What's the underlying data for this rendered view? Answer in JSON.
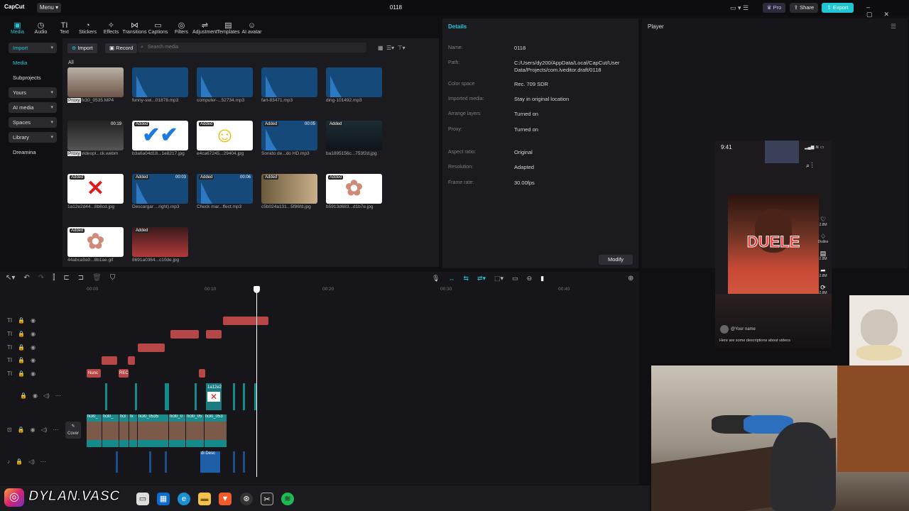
{
  "app": {
    "logo": "CapCut",
    "menu_label": "Menu",
    "project_title": "0118"
  },
  "titlebar": {
    "pro_label": "Pro",
    "share_label": "Share",
    "export_label": "Export"
  },
  "tool_tabs": [
    {
      "label": "Media",
      "icon": "media-icon",
      "glyph": "▣"
    },
    {
      "label": "Audio",
      "icon": "audio-icon",
      "glyph": "◷"
    },
    {
      "label": "Text",
      "icon": "text-icon",
      "glyph": "TI"
    },
    {
      "label": "Stickers",
      "icon": "stickers-icon",
      "glyph": "◔"
    },
    {
      "label": "Effects",
      "icon": "effects-icon",
      "glyph": "✧"
    },
    {
      "label": "Transitions",
      "icon": "transitions-icon",
      "glyph": "⋈"
    },
    {
      "label": "Captions",
      "icon": "captions-icon",
      "glyph": "▭"
    },
    {
      "label": "Filters",
      "icon": "filters-icon",
      "glyph": "◎"
    },
    {
      "label": "Adjustment",
      "icon": "adjustment-icon",
      "glyph": "⇌"
    },
    {
      "label": "Templates",
      "icon": "templates-icon",
      "glyph": "▤"
    },
    {
      "label": "AI avatar",
      "icon": "ai-avatar-icon",
      "glyph": "☺"
    }
  ],
  "sidebar": {
    "items": [
      {
        "label": "Import",
        "chevron": "▾"
      },
      {
        "label": "Media",
        "chevron": ""
      },
      {
        "label": "Subprojects",
        "chevron": ""
      },
      {
        "label": "Yours",
        "chevron": "▾"
      },
      {
        "label": "AI media",
        "chevron": "▾"
      },
      {
        "label": "Spaces",
        "chevron": "▾"
      },
      {
        "label": "Library",
        "chevron": "▾"
      },
      {
        "label": "Dreamina",
        "chevron": ""
      }
    ]
  },
  "media": {
    "import_label": "Import",
    "record_label": "Record",
    "search_placeholder": "Search media",
    "all_label": "All",
    "items": [
      {
        "caption": "fx30_0535.MP4",
        "badge": "",
        "duration": "",
        "proxy": "Proxy",
        "kind": "video"
      },
      {
        "caption": "funny-swi...01878.mp3",
        "badge": "",
        "duration": "",
        "proxy": "",
        "kind": "audio"
      },
      {
        "caption": "computer-...52734.mp3",
        "badge": "",
        "duration": "",
        "proxy": "",
        "kind": "audio"
      },
      {
        "caption": "fart-83471.mp3",
        "badge": "",
        "duration": "",
        "proxy": "",
        "kind": "audio"
      },
      {
        "caption": "ding-101492.mp3",
        "badge": "",
        "duration": "",
        "proxy": "",
        "kind": "audio"
      },
      {
        "caption": "videopl...ck.webm",
        "badge": "",
        "duration": "00:19",
        "proxy": "Proxy",
        "kind": "dark"
      },
      {
        "caption": "b3a6a04d18...1e8217.jpg",
        "badge": "Added",
        "duration": "",
        "proxy": "",
        "kind": "check"
      },
      {
        "caption": "e4ca67245...29404.jpg",
        "badge": "Added",
        "duration": "",
        "proxy": "",
        "kind": "emoji"
      },
      {
        "caption": "Sonido de...do HD.mp3",
        "badge": "Added",
        "duration": "00:05",
        "proxy": "",
        "kind": "audio"
      },
      {
        "caption": "ba1895156c...753f2d.jpg",
        "badge": "Added",
        "duration": "",
        "proxy": "",
        "kind": "night"
      },
      {
        "caption": "1a12e2d44...8b8cd.jpg",
        "badge": "Added",
        "duration": "",
        "proxy": "",
        "kind": "cross"
      },
      {
        "caption": "Descargar ...right).mp3",
        "badge": "Added",
        "duration": "00:03",
        "proxy": "",
        "kind": "audio"
      },
      {
        "caption": "Check mar...ffect.mp3",
        "badge": "Added",
        "duration": "00:06",
        "proxy": "",
        "kind": "audio"
      },
      {
        "caption": "c5b024a131...5f86fd.jpg",
        "badge": "Added",
        "duration": "",
        "proxy": "",
        "kind": "cats"
      },
      {
        "caption": "b5913d683...d1b7e.jpg",
        "badge": "Added",
        "duration": "",
        "proxy": "",
        "kind": "brain"
      },
      {
        "caption": "44abca9a9...8b1ae.gif",
        "badge": "Added",
        "duration": "00:02",
        "proxy": "",
        "kind": "brain"
      },
      {
        "caption": "8691a0364...c10de.jpg",
        "badge": "Added",
        "duration": "",
        "proxy": "",
        "kind": "scream"
      }
    ]
  },
  "details": {
    "header": "Details",
    "rows": [
      {
        "key": "Name:",
        "value": "0118"
      },
      {
        "key": "Path:",
        "value": "C:/Users/dy200/AppData/Local/CapCut/User Data/Projects/com.lveditor.draft/0118"
      },
      {
        "key": "Color space",
        "value": "Rec. 709 SDR"
      },
      {
        "key": "Imported media:",
        "value": "Stay in original location"
      },
      {
        "key": "Arrange layers",
        "value": "Turned on"
      },
      {
        "key": "Proxy:",
        "value": "Turned on"
      },
      {
        "key": "Aspect ratio:",
        "value": "Original"
      },
      {
        "key": "Resolution:",
        "value": "Adapted"
      },
      {
        "key": "Frame rate:",
        "value": "30.00fps"
      }
    ],
    "modify_label": "Modify"
  },
  "player": {
    "header": "Player",
    "phone_time": "9:41",
    "overlay_text": "DUELE",
    "username": "@Your name",
    "description": "Here are some descriptions about videos",
    "side_counts": [
      "2.8M",
      "Dislike",
      "2.8M",
      "2.8M",
      "2.8M"
    ]
  },
  "timeline": {
    "ruler": [
      "00:00",
      "00:10",
      "00:20",
      "00:30",
      "00:40"
    ],
    "cover_label": "Cover",
    "clip_labels": {
      "nunc": "Nunc",
      "rec": "REC",
      "img": "1a12e2",
      "audio1": "di",
      "audio2": "Desc",
      "video": [
        "fx30_",
        "fx30_",
        "fx3",
        "fx",
        "fx30_0535",
        "fx30_0",
        "fx30_05",
        "fx30_053"
      ]
    }
  },
  "webcam": {
    "watermark": "DYLAN.VASC"
  }
}
